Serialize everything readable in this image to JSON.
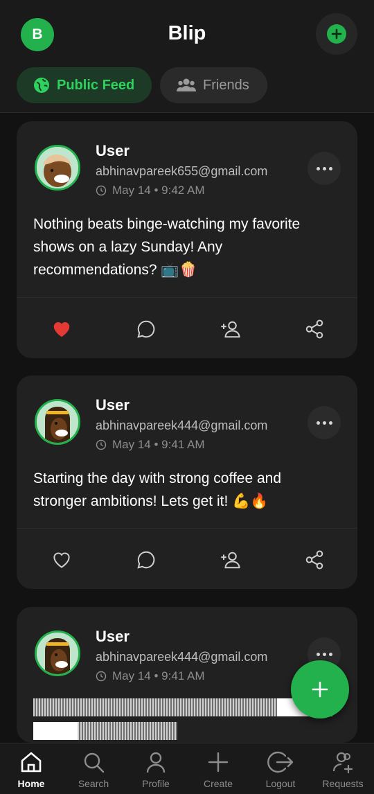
{
  "header": {
    "avatar_initial": "B",
    "title": "Blip"
  },
  "tabs": [
    {
      "label": "Public Feed",
      "active": true
    },
    {
      "label": "Friends",
      "active": false
    }
  ],
  "posts": [
    {
      "username": "User",
      "email": "abhinavpareek655@gmail.com",
      "timestamp": "May 14 • 9:42 AM",
      "content": "Nothing beats binge-watching my favorite shows on a lazy Sunday! Any recommendations? 📺🍿",
      "liked": true
    },
    {
      "username": "User",
      "email": "abhinavpareek444@gmail.com",
      "timestamp": "May 14 • 9:41 AM",
      "content": "Starting the day with strong coffee and stronger ambitions! Lets get it! 💪🔥",
      "liked": false
    },
    {
      "username": "User",
      "email": "abhinavpareek444@gmail.com",
      "timestamp": "May 14 • 9:41 AM",
      "content": "",
      "liked": false
    }
  ],
  "nav": [
    {
      "label": "Home",
      "icon": "home-icon",
      "active": true
    },
    {
      "label": "Search",
      "icon": "search-icon",
      "active": false
    },
    {
      "label": "Profile",
      "icon": "profile-icon",
      "active": false
    },
    {
      "label": "Create",
      "icon": "plus-icon",
      "active": false
    },
    {
      "label": "Logout",
      "icon": "logout-icon",
      "active": false
    },
    {
      "label": "Requests",
      "icon": "requests-icon",
      "active": false
    }
  ],
  "colors": {
    "accent": "#22b14c",
    "background": "#121212",
    "card": "#212121",
    "like": "#e53935"
  }
}
